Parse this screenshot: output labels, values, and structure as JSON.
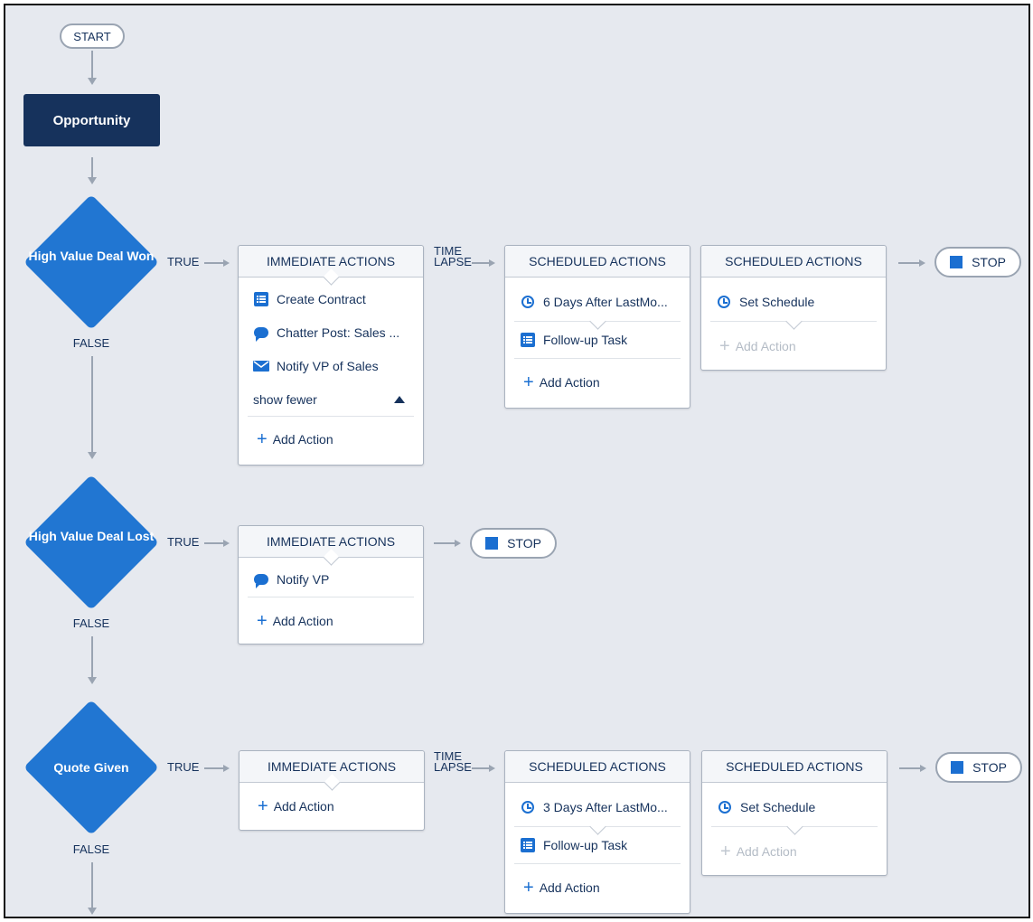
{
  "flow": {
    "start_label": "START",
    "object_label": "Opportunity",
    "true_label": "TRUE",
    "false_label": "FALSE",
    "time_lapse_label": "TIME\nLAPSE",
    "stop_label": "STOP"
  },
  "criteria": [
    {
      "label": "High Value Deal Won",
      "immediate": {
        "title": "IMMEDIATE ACTIONS",
        "actions": [
          {
            "icon": "list-icon",
            "label": "Create Contract"
          },
          {
            "icon": "chat-icon",
            "label": "Chatter Post: Sales ..."
          },
          {
            "icon": "email-icon",
            "label": "Notify VP of Sales"
          }
        ],
        "show_fewer": "show fewer",
        "add_action": "Add Action"
      },
      "scheduled": [
        {
          "title": "SCHEDULED ACTIONS",
          "schedule": "6 Days After LastMo...",
          "actions": [
            {
              "icon": "list-icon",
              "label": "Follow-up Task"
            }
          ],
          "add_action": "Add Action"
        },
        {
          "title": "SCHEDULED ACTIONS",
          "schedule": "Set Schedule",
          "actions": [],
          "add_action": "Add Action",
          "add_disabled": true
        }
      ]
    },
    {
      "label": "High Value Deal Lost",
      "immediate": {
        "title": "IMMEDIATE ACTIONS",
        "actions": [
          {
            "icon": "chat-icon",
            "label": "Notify VP"
          }
        ],
        "add_action": "Add Action"
      }
    },
    {
      "label": "Quote Given",
      "immediate": {
        "title": "IMMEDIATE ACTIONS",
        "actions": [],
        "add_action": "Add Action"
      },
      "scheduled": [
        {
          "title": "SCHEDULED ACTIONS",
          "schedule": "3 Days After LastMo...",
          "actions": [
            {
              "icon": "list-icon",
              "label": "Follow-up Task"
            }
          ],
          "add_action": "Add Action"
        },
        {
          "title": "SCHEDULED ACTIONS",
          "schedule": "Set Schedule",
          "actions": [],
          "add_action": "Add Action",
          "add_disabled": true
        }
      ]
    }
  ],
  "colors": {
    "brand": "#2176d2",
    "navy": "#16325c",
    "canvas": "#e6e9ef"
  }
}
